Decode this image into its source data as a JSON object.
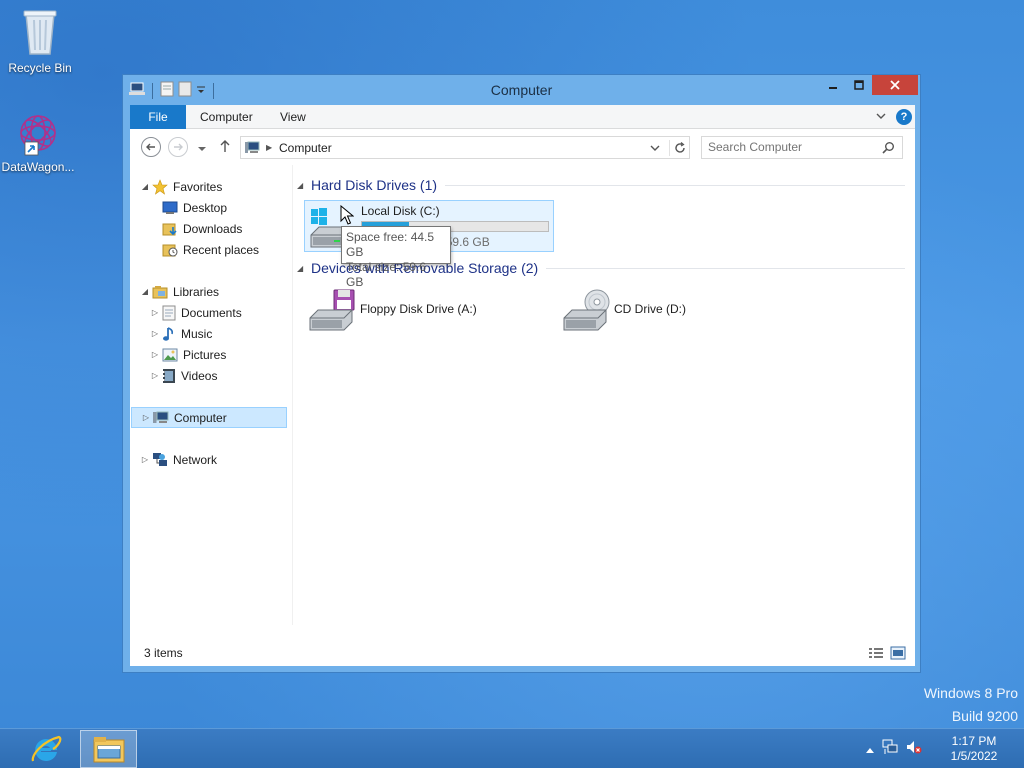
{
  "desktop": {
    "icons": [
      {
        "label": "Recycle Bin",
        "icon": "recycle-bin-icon"
      },
      {
        "label": "DataWagon...",
        "icon": "datawagon-icon"
      }
    ],
    "watermark": {
      "line1": "Windows 8 Pro",
      "line2": "Build 9200"
    }
  },
  "window": {
    "title": "Computer",
    "ribbon_tabs": {
      "file": "File",
      "computer": "Computer",
      "view": "View"
    },
    "address": {
      "crumb": "Computer"
    },
    "search": {
      "placeholder": "Search Computer"
    },
    "nav": {
      "favorites": "Favorites",
      "desktop": "Desktop",
      "downloads": "Downloads",
      "recent": "Recent places",
      "libraries": "Libraries",
      "documents": "Documents",
      "music": "Music",
      "pictures": "Pictures",
      "videos": "Videos",
      "computer": "Computer",
      "network": "Network"
    },
    "groups": {
      "hdd": "Hard Disk Drives (1)",
      "removable": "Devices with Removable Storage (2)"
    },
    "drives": {
      "c": {
        "name": "Local Disk (C:)",
        "sub": "44.5 GB free of 59.6 GB",
        "used_fraction": 0.253
      },
      "a": {
        "name": "Floppy Disk Drive (A:)"
      },
      "d": {
        "name": "CD Drive (D:)"
      }
    },
    "tooltip": {
      "line1": "Space free: 44.5 GB",
      "line2": "Total size: 59.6 GB"
    },
    "status": {
      "count": "3 items"
    }
  },
  "taskbar": {
    "clock": {
      "time": "1:17 PM",
      "date": "1/5/2022"
    }
  },
  "colors": {
    "accent": "#1979ca",
    "selection": "#cce8ff",
    "bar_fill": "#26a0da",
    "close": "#c7443b"
  }
}
